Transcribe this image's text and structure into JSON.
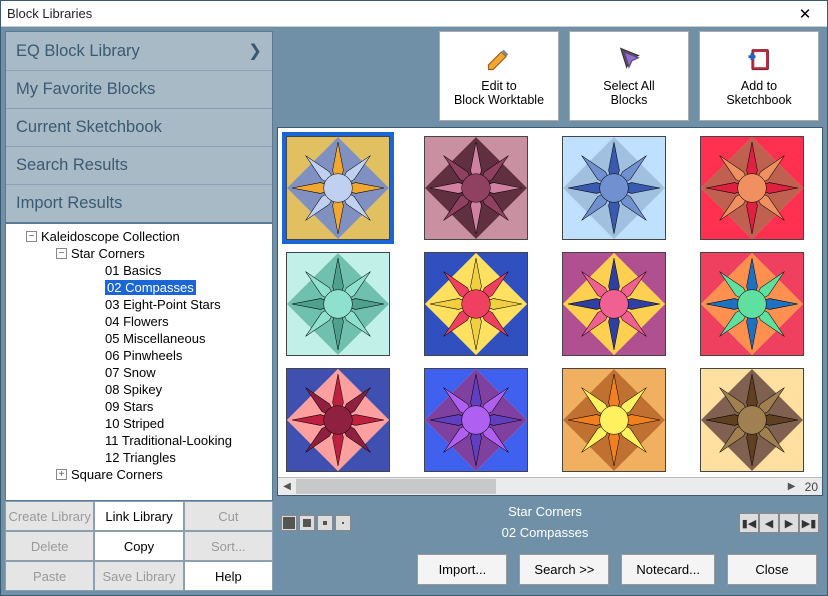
{
  "window": {
    "title": "Block Libraries"
  },
  "nav": [
    "EQ Block Library",
    "My Favorite Blocks",
    "Current Sketchbook",
    "Search Results",
    "Import Results"
  ],
  "tree": {
    "root": "Kaleidoscope Collection",
    "parent": "Star Corners",
    "selected": "02 Compasses",
    "items": [
      "01 Basics",
      "02 Compasses",
      "03 Eight-Point Stars",
      "04 Flowers",
      "05 Miscellaneous",
      "06 Pinwheels",
      "07 Snow",
      "08 Spikey",
      "09 Stars",
      "10 Striped",
      "11 Traditional-Looking",
      "12 Triangles"
    ],
    "next_parent": "Square Corners"
  },
  "left_buttons": {
    "create": "Create Library",
    "link": "Link Library",
    "cut": "Cut",
    "delete": "Delete",
    "copy": "Copy",
    "sort": "Sort...",
    "paste": "Paste",
    "save": "Save Library",
    "help": "Help"
  },
  "toolbar": {
    "edit": {
      "l1": "Edit to",
      "l2": "Block Worktable"
    },
    "select": {
      "l1": "Select All",
      "l2": "Blocks"
    },
    "add": {
      "l1": "Add to",
      "l2": "Sketchbook"
    }
  },
  "status": {
    "title": "Star Corners",
    "subtitle": "02 Compasses",
    "count": "20"
  },
  "bottom": {
    "import": "Import...",
    "search": "Search   >>",
    "notecard": "Notecard...",
    "close": "Close"
  },
  "block_colors": [
    [
      "#f0a830",
      "#c0d0f0",
      "#e0c060",
      "#8090c0"
    ],
    [
      "#d080a0",
      "#904060",
      "#c890a0",
      "#603040"
    ],
    [
      "#3a5ab0",
      "#7090d0",
      "#c0e0ff",
      "#a0c0e0"
    ],
    [
      "#e02040",
      "#f09060",
      "#ff3050",
      "#c06050"
    ],
    [
      "#50a090",
      "#90e0d0",
      "#c0f0e8",
      "#70c0b0"
    ],
    [
      "#f0d040",
      "#f04060",
      "#3050c0",
      "#ffe060"
    ],
    [
      "#3040a0",
      "#f06090",
      "#b05090",
      "#ffd050"
    ],
    [
      "#2070c0",
      "#60e0a0",
      "#f04060",
      "#ff9050"
    ],
    [
      "#c02040",
      "#902040",
      "#4050b0",
      "#ffa0a0"
    ],
    [
      "#6040c0",
      "#b060f0",
      "#4060f0",
      "#8040a0"
    ],
    [
      "#f08020",
      "#fff060",
      "#f0b060",
      "#c07030"
    ],
    [
      "#604020",
      "#a08050",
      "#ffe0a0",
      "#806050"
    ]
  ]
}
